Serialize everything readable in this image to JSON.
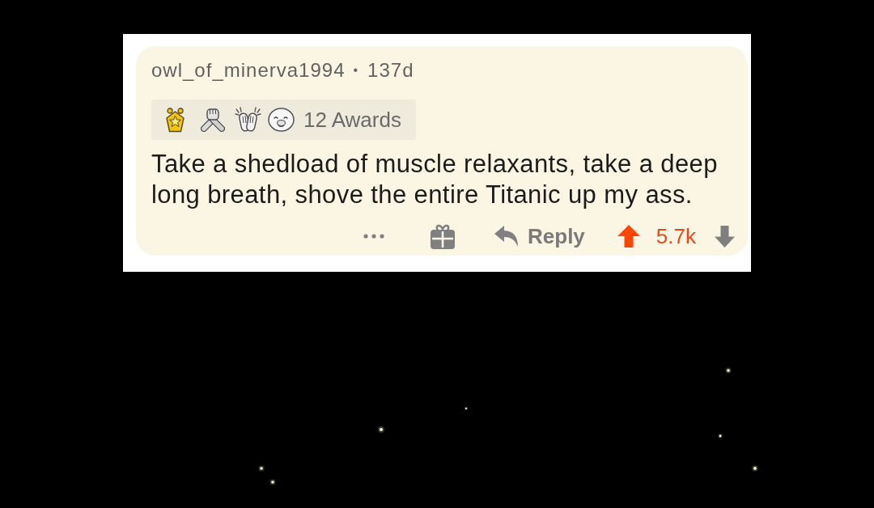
{
  "comment": {
    "author": "owl_of_minerva1994",
    "separator": "•",
    "age": "137d",
    "awards": {
      "label": "12 Awards"
    },
    "body": "Take a shedload of muscle relaxants, take a deep long breath, shove the entire Titanic up my ass.",
    "actions": {
      "reply": "Reply",
      "score": "5.7k",
      "upvoted": true,
      "downvoted": false
    }
  }
}
